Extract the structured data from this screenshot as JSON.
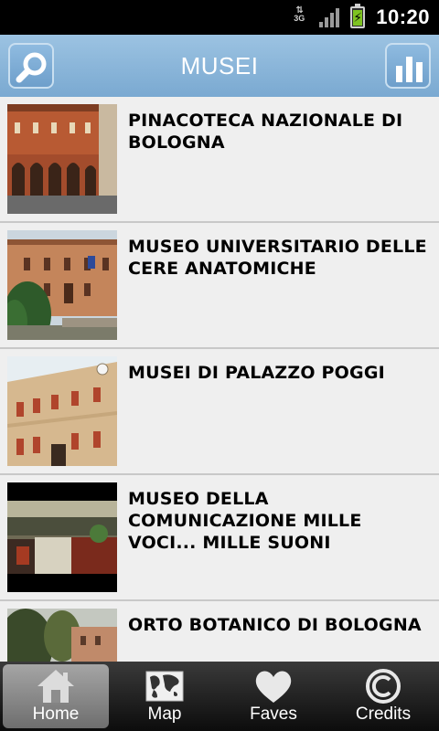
{
  "status_bar": {
    "network": "3G",
    "time": "10:20"
  },
  "header": {
    "title": "MUSEI"
  },
  "items": [
    {
      "title": "PINACOTECA NAZIONALE DI BOLOGNA"
    },
    {
      "title": "MUSEO UNIVERSITARIO DELLE CERE ANATOMICHE"
    },
    {
      "title": "MUSEI DI PALAZZO POGGI"
    },
    {
      "title": "MUSEO DELLA COMUNICAZIONE MILLE VOCI... MILLE SUONI"
    },
    {
      "title": "ORTO BOTANICO DI BOLOGNA"
    }
  ],
  "tabs": [
    {
      "label": "Home",
      "icon": "home-icon",
      "active": true
    },
    {
      "label": "Map",
      "icon": "map-icon",
      "active": false
    },
    {
      "label": "Faves",
      "icon": "heart-icon",
      "active": false
    },
    {
      "label": "Credits",
      "icon": "copyright-icon",
      "active": false
    }
  ],
  "colors": {
    "header": "#7aa9d1",
    "list_background": "#efefef",
    "tabbar": "#1a1a1a",
    "battery": "#7ec321"
  }
}
